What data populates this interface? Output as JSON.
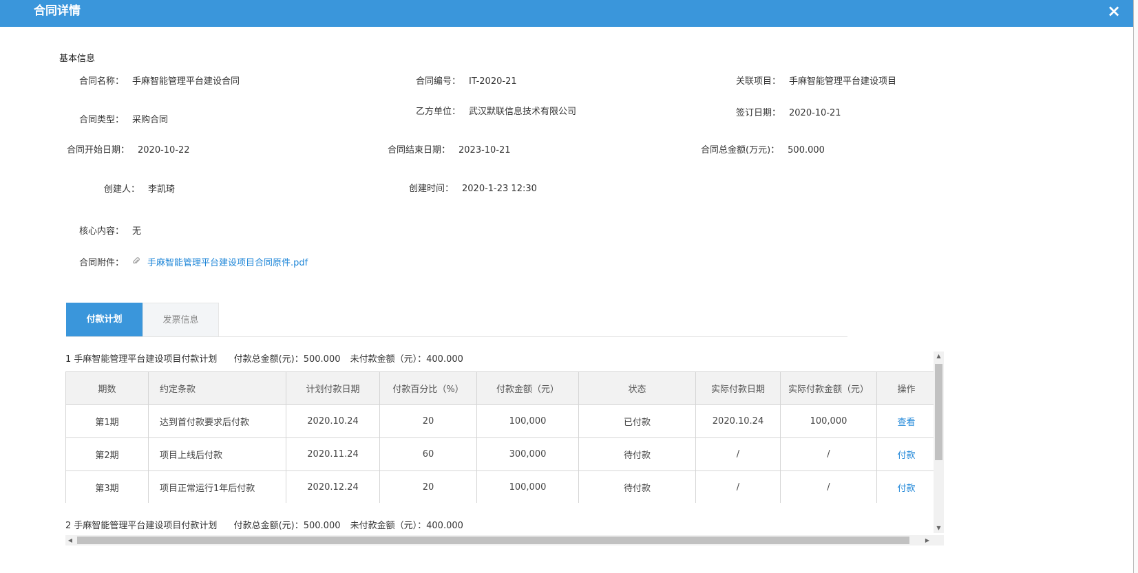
{
  "dialog": {
    "title": "合同详情",
    "close_icon": "×"
  },
  "section_title": "基本信息",
  "fields": {
    "contract_name": {
      "label": "合同名称：",
      "value": "手麻智能管理平台建设合同"
    },
    "contract_no": {
      "label": "合同编号：",
      "value": "IT-2020-21"
    },
    "related_project": {
      "label": "关联项目：",
      "value": "手麻智能管理平台建设项目"
    },
    "contract_type": {
      "label": "合同类型：",
      "value": "采购合同"
    },
    "party_b": {
      "label": "乙方单位：",
      "value": "武汉默联信息技术有限公司"
    },
    "sign_date": {
      "label": "签订日期：",
      "value": "2020-10-21"
    },
    "start_date": {
      "label": "合同开始日期：",
      "value": "2020-10-22"
    },
    "end_date": {
      "label": "合同结束日期：",
      "value": "2023-10-21"
    },
    "total_amount": {
      "label": "合同总金额(万元)：",
      "value": "500.000"
    },
    "creator": {
      "label": "创建人：",
      "value": "李凯琦"
    },
    "created_time": {
      "label": "创建时间：",
      "value": "2020-1-23 12:30"
    },
    "core_content": {
      "label": "核心内容：",
      "value": "无"
    },
    "attachment": {
      "label": "合同附件：",
      "value": "手麻智能管理平台建设项目合同原件.pdf",
      "icon": "paperclip-icon"
    }
  },
  "tabs": {
    "payment_plan": "付款计划",
    "invoice_info": "发票信息"
  },
  "plans": [
    {
      "index": "1",
      "name": "手麻智能管理平台建设项目付款计划",
      "total": "付款总金额(元)：500.000",
      "unpaid": "未付款金额（元）：400.000"
    },
    {
      "index": "2",
      "name": "手麻智能管理平台建设项目付款计划",
      "total": "付款总金额(元)：500.000",
      "unpaid": "未付款金额（元）：400.000"
    }
  ],
  "table": {
    "headers": [
      "期数",
      "约定条款",
      "计划付款日期",
      "付款百分比（%）",
      "付款金额（元）",
      "状态",
      "实际付款日期",
      "实际付款金额（元）",
      "操作"
    ],
    "rows": [
      [
        "第1期",
        "达到首付款要求后付款",
        "2020.10.24",
        "20",
        "100,000",
        "已付款",
        "2020.10.24",
        "100,000",
        "查看"
      ],
      [
        "第2期",
        "项目上线后付款",
        "2020.11.24",
        "60",
        "300,000",
        "待付款",
        "/",
        "/",
        "付款"
      ],
      [
        "第3期",
        "项目正常运行1年后付款",
        "2020.12.24",
        "20",
        "100,000",
        "待付款",
        "/",
        "/",
        "付款"
      ]
    ]
  },
  "scroll": {
    "up": "▲",
    "down": "▼",
    "left": "◀",
    "right": "▶"
  }
}
